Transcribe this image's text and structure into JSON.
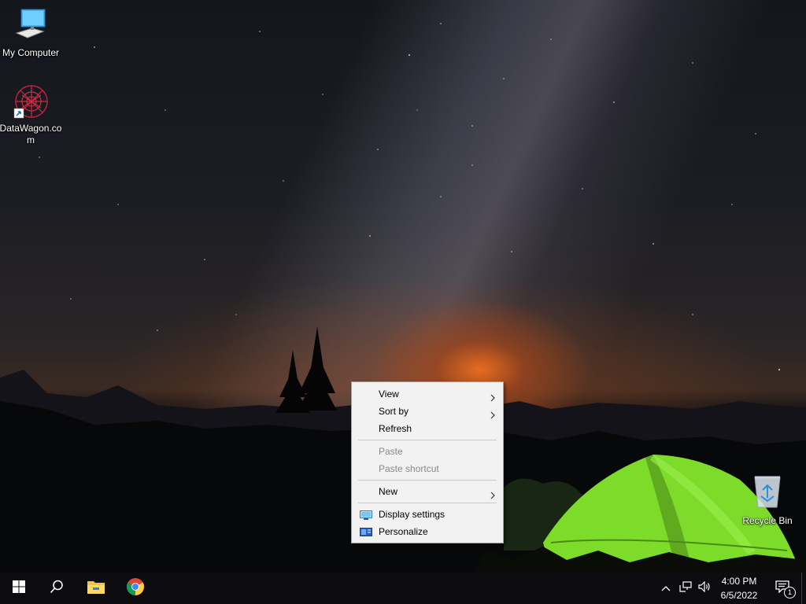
{
  "desktop": {
    "icons": [
      {
        "label": "My Computer",
        "icon": "computer-icon"
      },
      {
        "label": "DataWagon.com",
        "icon": "datawagon-icon"
      },
      {
        "label": "Recycle Bin",
        "icon": "recycle-bin-icon"
      }
    ]
  },
  "context_menu": {
    "items": [
      {
        "label": "View",
        "submenu": true,
        "enabled": true
      },
      {
        "label": "Sort by",
        "submenu": true,
        "enabled": true
      },
      {
        "label": "Refresh",
        "submenu": false,
        "enabled": true
      },
      {
        "label": "Paste",
        "submenu": false,
        "enabled": false
      },
      {
        "label": "Paste shortcut",
        "submenu": false,
        "enabled": false
      },
      {
        "label": "New",
        "submenu": true,
        "enabled": true
      },
      {
        "label": "Display settings",
        "submenu": false,
        "enabled": true,
        "icon": "display-icon"
      },
      {
        "label": "Personalize",
        "submenu": false,
        "enabled": true,
        "icon": "personalize-icon"
      }
    ]
  },
  "taskbar": {
    "pinned": [
      "start-icon",
      "search-icon",
      "file-explorer-icon",
      "chrome-icon"
    ],
    "tray": [
      "chevron-up-icon",
      "network-icon",
      "volume-icon"
    ],
    "clock": {
      "time": "4:00 PM",
      "date": "6/5/2022"
    },
    "notifications": {
      "count": "1"
    }
  },
  "colors": {
    "menu_bg": "#f2f2f2",
    "menu_disabled": "#8a8a8a",
    "taskbar_bg": "#0b0b10",
    "tent_green": "#7ddc2a",
    "horizon_orange": "#ee6e1e"
  }
}
